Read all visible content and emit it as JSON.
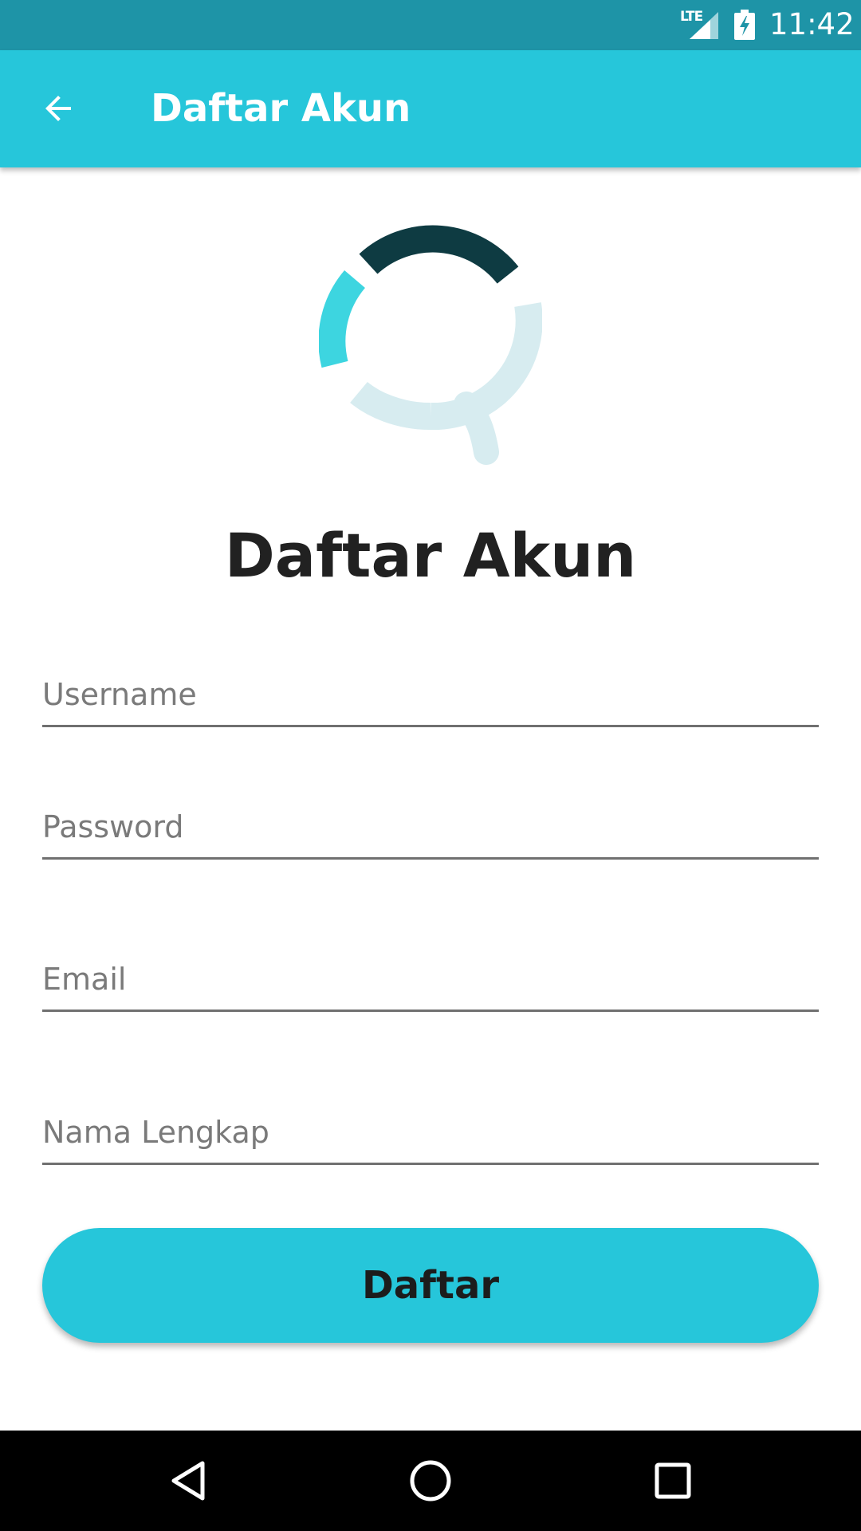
{
  "status_bar": {
    "network": "LTE",
    "time": "11:42"
  },
  "app_bar": {
    "title": "Daftar Akun",
    "back_icon": "arrow-left-icon"
  },
  "logo": {
    "name": "q-logo-icon",
    "colors": {
      "dark": "#0e3b42",
      "accent": "#3dd5e0",
      "light": "#d7ecf0"
    }
  },
  "form": {
    "heading": "Daftar Akun",
    "fields": [
      {
        "name": "username",
        "placeholder": "Username",
        "value": ""
      },
      {
        "name": "password",
        "placeholder": "Password",
        "value": ""
      },
      {
        "name": "email",
        "placeholder": "Email",
        "value": ""
      },
      {
        "name": "full_name",
        "placeholder": "Nama Lengkap",
        "value": ""
      }
    ],
    "submit_label": "Daftar"
  },
  "nav_bar": {
    "icons": [
      "back-triangle-icon",
      "home-circle-icon",
      "recents-square-icon"
    ]
  },
  "colors": {
    "status_bar": "#1e94a7",
    "primary": "#26c6da",
    "nav_bar": "#000000"
  }
}
